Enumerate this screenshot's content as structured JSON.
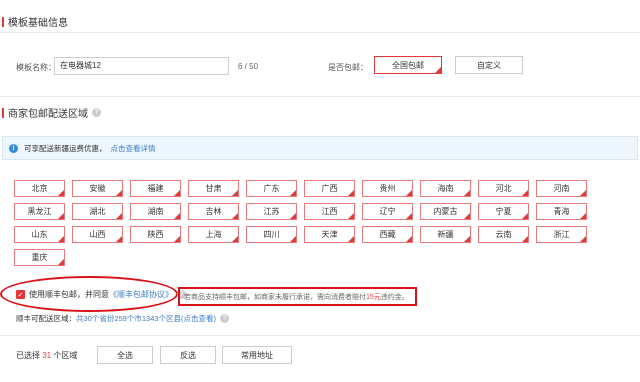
{
  "basic": {
    "title": "模板基础信息",
    "name_label": "模板名称：",
    "name_value": "在电器城12",
    "name_counter": "6 / 50",
    "free_ship_label": "是否包邮：",
    "free_ship_options": [
      "全国包邮",
      "自定义"
    ],
    "free_ship_selected": "全国包邮"
  },
  "delivery": {
    "title": "商家包邮配送区域",
    "info_text": "可享配送新疆运费优惠，",
    "info_link": "点击查看详情",
    "regions": [
      [
        "北京",
        "安徽",
        "福建",
        "甘肃",
        "广东",
        "广西",
        "贵州",
        "海南",
        "河北",
        "河南"
      ],
      [
        "黑龙江",
        "湖北",
        "湖南",
        "吉林",
        "江苏",
        "江西",
        "辽宁",
        "内蒙古",
        "宁夏",
        "青海"
      ],
      [
        "山东",
        "山西",
        "陕西",
        "上海",
        "四川",
        "天津",
        "西藏",
        "新疆",
        "云南",
        "浙江"
      ],
      [
        "重庆"
      ]
    ],
    "agree_prefix": "使用顺丰包邮，并同意",
    "agree_link": "《顺丰包邮协议》",
    "warning_prefix": "若商品支持顺丰包邮，如商家未履行承诺，需向消费者赔付",
    "warning_amount": "15元",
    "warning_suffix": "违约金。",
    "area_label": "顺丰可配送区域：",
    "area_link": "共30个省份259个市1343个区县(点击查看)",
    "selected_prefix": "已选择",
    "selected_count": "31",
    "selected_suffix": "个区域",
    "buttons": [
      "全选",
      "反选",
      "常用地址"
    ]
  },
  "icons": {
    "help": "question-circle-icon",
    "info": "info-circle-icon",
    "checkbox": "checkmark-icon"
  },
  "colors": {
    "accent": "#e4393c",
    "annotation": "#d9121a",
    "link": "#3b7cc6",
    "info_bg": "#eef6fd"
  }
}
